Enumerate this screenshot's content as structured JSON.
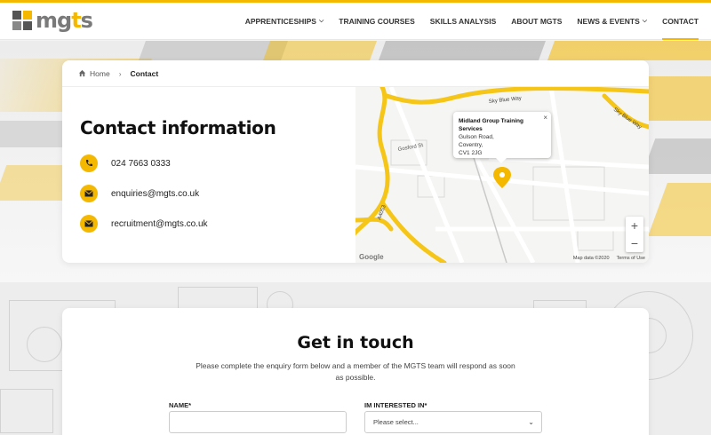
{
  "brand": {
    "logo_text_a": "mg",
    "logo_text_b": "t",
    "logo_text_c": "s",
    "accent": "#f5b800"
  },
  "nav": {
    "items": [
      {
        "label": "APPRENTICESHIPS",
        "has_dropdown": true
      },
      {
        "label": "TRAINING COURSES",
        "has_dropdown": false
      },
      {
        "label": "SKILLS ANALYSIS",
        "has_dropdown": false
      },
      {
        "label": "ABOUT MGTS",
        "has_dropdown": false
      },
      {
        "label": "NEWS & EVENTS",
        "has_dropdown": true
      },
      {
        "label": "CONTACT",
        "has_dropdown": false,
        "active": true
      }
    ]
  },
  "breadcrumb": {
    "home": "Home",
    "current": "Contact"
  },
  "contact": {
    "title": "Contact information",
    "phone": "024 7663 0333",
    "email1": "enquiries@mgts.co.uk",
    "email2": "recruitment@mgts.co.uk"
  },
  "map": {
    "popup_title": "Midland Group Training Services",
    "popup_line1": "Gulson Road,",
    "popup_line2": "Coventry,",
    "popup_line3": "CV1 2JG",
    "road_sky_blue_way": "Sky Blue Way",
    "road_a4053": "A4053",
    "road_gosford": "Gosford St",
    "map_data": "Map data ©2020",
    "terms": "Terms of Use",
    "google": "Google",
    "zoom_in": "+",
    "zoom_out": "−"
  },
  "form": {
    "title": "Get in touch",
    "description": "Please complete the enquiry form below and a member of the MGTS team will respond as soon as possible.",
    "name_label": "NAME*",
    "interest_label": "IM INTERESTED IN*",
    "interest_value": "Please select..."
  }
}
